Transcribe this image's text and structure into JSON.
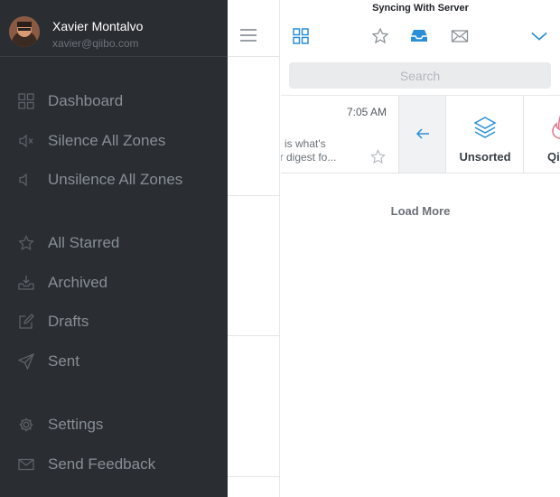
{
  "profile": {
    "name": "Xavier Montalvo",
    "email": "xavier@qiibo.com"
  },
  "sidebar": {
    "items": [
      {
        "label": "Dashboard",
        "icon": "grid-icon"
      },
      {
        "label": "Silence All Zones",
        "icon": "speaker-mute-icon"
      },
      {
        "label": "Unsilence All Zones",
        "icon": "speaker-icon"
      },
      {
        "label": "All Starred",
        "icon": "star-icon"
      },
      {
        "label": "Archived",
        "icon": "archive-tray-icon"
      },
      {
        "label": "Drafts",
        "icon": "edit-icon"
      },
      {
        "label": "Sent",
        "icon": "paper-plane-icon"
      },
      {
        "label": "Settings",
        "icon": "gear-icon"
      },
      {
        "label": "Send Feedback",
        "icon": "envelope-icon"
      }
    ]
  },
  "header": {
    "status": "Syncing With Server",
    "tabs": [
      {
        "icon": "grid-icon",
        "state": "inactive"
      },
      {
        "icon": "star-icon",
        "state": "inactive"
      },
      {
        "icon": "inbox-tray-icon",
        "state": "active"
      },
      {
        "icon": "envelope-icon",
        "state": "inactive"
      },
      {
        "icon": "chevron-down-icon",
        "state": "inactive"
      }
    ]
  },
  "search": {
    "placeholder": "Search"
  },
  "email": {
    "time": "7:05 AM",
    "preview_line1": "e is what's",
    "preview_line2": "Ur digest fo...",
    "starred": false
  },
  "swipe_actions": [
    {
      "label": "",
      "icon": "arrow-left-icon"
    },
    {
      "label": "Unsorted",
      "icon": "layers-icon"
    },
    {
      "label": "Qi",
      "icon": "flame-icon"
    }
  ],
  "list": {
    "load_more": "Load More"
  },
  "colors": {
    "sidebar_bg": "#2a2d31",
    "accent": "#2a8fd6",
    "flame": "#e8708a"
  }
}
